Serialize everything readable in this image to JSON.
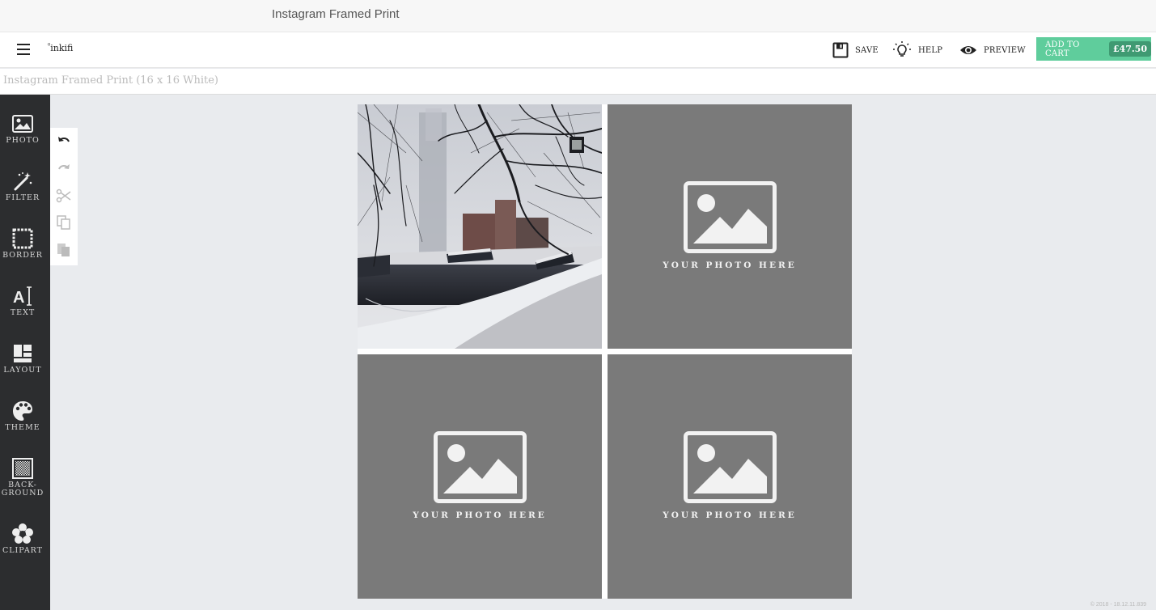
{
  "browser": {
    "tab_title": "Instagram Framed Print"
  },
  "header": {
    "logo": "inkifi",
    "save_label": "SAVE",
    "help_label": "HELP",
    "preview_label": "PREVIEW",
    "cart_label": "ADD TO CART",
    "cart_price": "£47.50"
  },
  "product": {
    "subtitle": "Instagram Framed Print (16 x 16 White)"
  },
  "sidebar": {
    "items": [
      {
        "label": "PHOTO",
        "icon": "photo-icon"
      },
      {
        "label": "FILTER",
        "icon": "magic-wand-icon"
      },
      {
        "label": "BORDER",
        "icon": "border-icon"
      },
      {
        "label": "TEXT",
        "icon": "text-icon"
      },
      {
        "label": "LAYOUT",
        "icon": "layout-icon"
      },
      {
        "label": "THEME",
        "icon": "palette-icon"
      },
      {
        "label": "BACK-\nGROUND",
        "icon": "background-icon"
      },
      {
        "label": "CLIPART",
        "icon": "flower-icon"
      }
    ]
  },
  "toolbar": {
    "tools": [
      "undo-icon",
      "redo-icon",
      "cut-icon",
      "copy-icon",
      "paste-icon"
    ]
  },
  "canvas": {
    "placeholder_text": "YOUR PHOTO HERE",
    "cells": [
      {
        "state": "photo",
        "description_icon": "snowy-canal-photo"
      },
      {
        "state": "empty",
        "text": "YOUR PHOTO HERE"
      },
      {
        "state": "empty",
        "text": "YOUR PHOTO HERE"
      },
      {
        "state": "empty",
        "text": "YOUR PHOTO HERE"
      }
    ]
  },
  "footer": {
    "version": "© 2018 - 18.12.11.839"
  },
  "colors": {
    "accent": "#5fcd9c",
    "accent_dark": "#3f9a72",
    "sidebar_bg": "#2c2d2f",
    "placeholder_bg": "#7a7a7a",
    "workspace_bg": "#e9ebee"
  }
}
